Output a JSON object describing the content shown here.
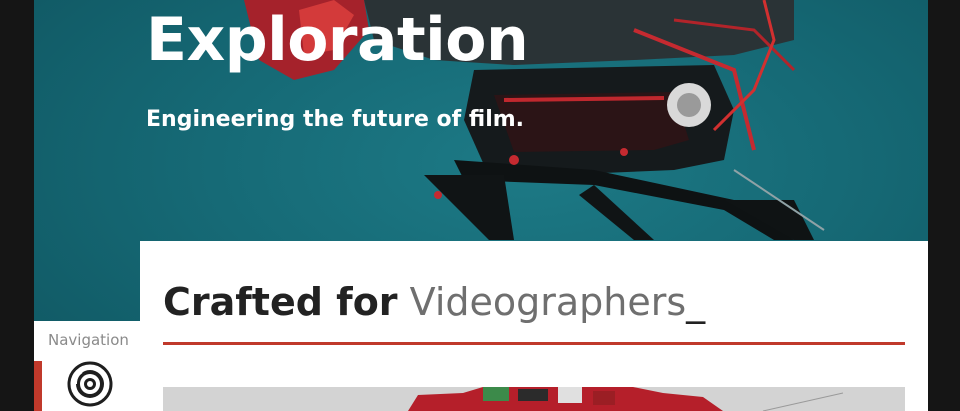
{
  "hero": {
    "title": "Exploration",
    "subtitle": "Engineering the future of film."
  },
  "content": {
    "headline_strong": "Crafted for",
    "headline_light": "Videographers",
    "headline_cursor": "_"
  },
  "navigation": {
    "label": "Navigation"
  },
  "colors": {
    "accent": "#c0392b",
    "hero_background": "#166a76",
    "frame": "#151515",
    "headline_dark": "#222222",
    "headline_light": "#6f6f6f"
  },
  "icons": {
    "nav_logo": "camera-lens-logo-icon"
  }
}
